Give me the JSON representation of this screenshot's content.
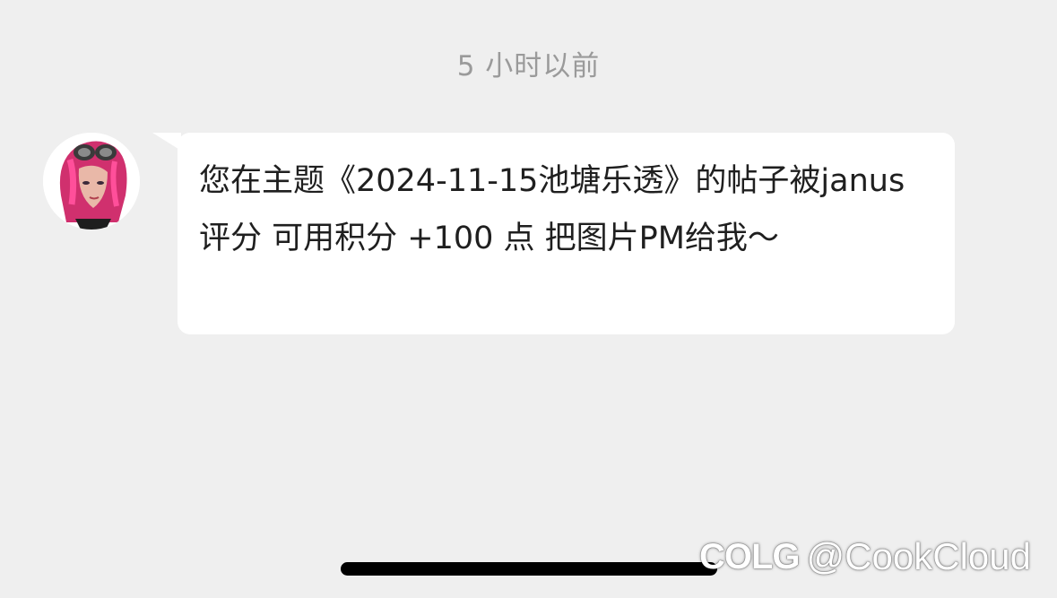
{
  "chat": {
    "timestamp": "5 小时以前",
    "message": {
      "sender_avatar": "pink-haired-character-avatar",
      "text": "您在主题《2024-11-15池塘乐透》的帖子被janus 评分 可用积分 +100 点 把图片PM给我～"
    }
  },
  "watermark": {
    "logo": "COLG",
    "handle": "@CookCloud"
  },
  "colors": {
    "background": "#efefef",
    "bubble": "#ffffff",
    "timestamp": "#9a9a9a",
    "text": "#1f1f1f"
  }
}
